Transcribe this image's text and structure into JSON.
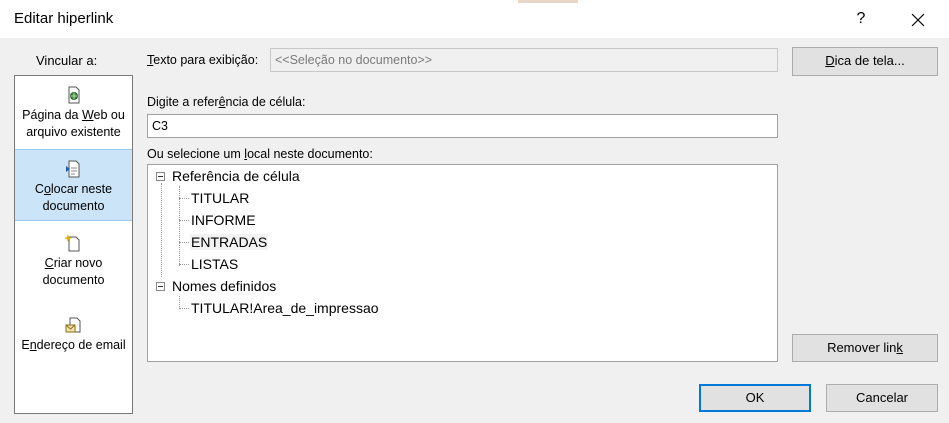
{
  "dialog": {
    "title": "Editar hiperlink",
    "help_glyph": "?",
    "close_glyph": "✕"
  },
  "link_to": {
    "label": "Vincular a:",
    "items": [
      {
        "icon": "web-page-icon",
        "label_before": "Página da ",
        "label_ul": "W",
        "label_after": "eb ou arquivo existente",
        "selected": false
      },
      {
        "icon": "document-place-icon",
        "label_before": "C",
        "label_ul": "o",
        "label_after": "locar neste documento",
        "selected": true
      },
      {
        "icon": "new-document-icon",
        "label_before": "",
        "label_ul": "C",
        "label_after": "riar novo documento",
        "selected": false
      },
      {
        "icon": "email-icon",
        "label_before": "E",
        "label_ul": "n",
        "label_after": "dereço de email",
        "selected": false
      }
    ]
  },
  "display_text": {
    "label_ul": "T",
    "label_rest": "exto para exibição:",
    "value": "<<Seleção no documento>>"
  },
  "screen_tip": {
    "label_ul": "D",
    "label_rest": "ica de tela..."
  },
  "cell_ref": {
    "label_before": "Digite a refer",
    "label_ul": "ê",
    "label_after": "ncia de célula:",
    "value": "C3"
  },
  "place": {
    "label_before": "Ou selecione um ",
    "label_ul": "l",
    "label_after": "ocal neste documento:",
    "tree": [
      {
        "text": "Referência de célula",
        "level": 0
      },
      {
        "text": "TITULAR",
        "level": 1
      },
      {
        "text": "INFORME",
        "level": 1
      },
      {
        "text": "ENTRADAS",
        "level": 1,
        "highlight": true
      },
      {
        "text": "LISTAS",
        "level": 1
      },
      {
        "text": "Nomes definidos",
        "level": 0
      },
      {
        "text": "TITULAR!Area_de_impressao",
        "level": 1
      }
    ]
  },
  "buttons": {
    "remove_before": "Remover lin",
    "remove_ul": "k",
    "ok": "OK",
    "cancel": "Cancelar"
  }
}
